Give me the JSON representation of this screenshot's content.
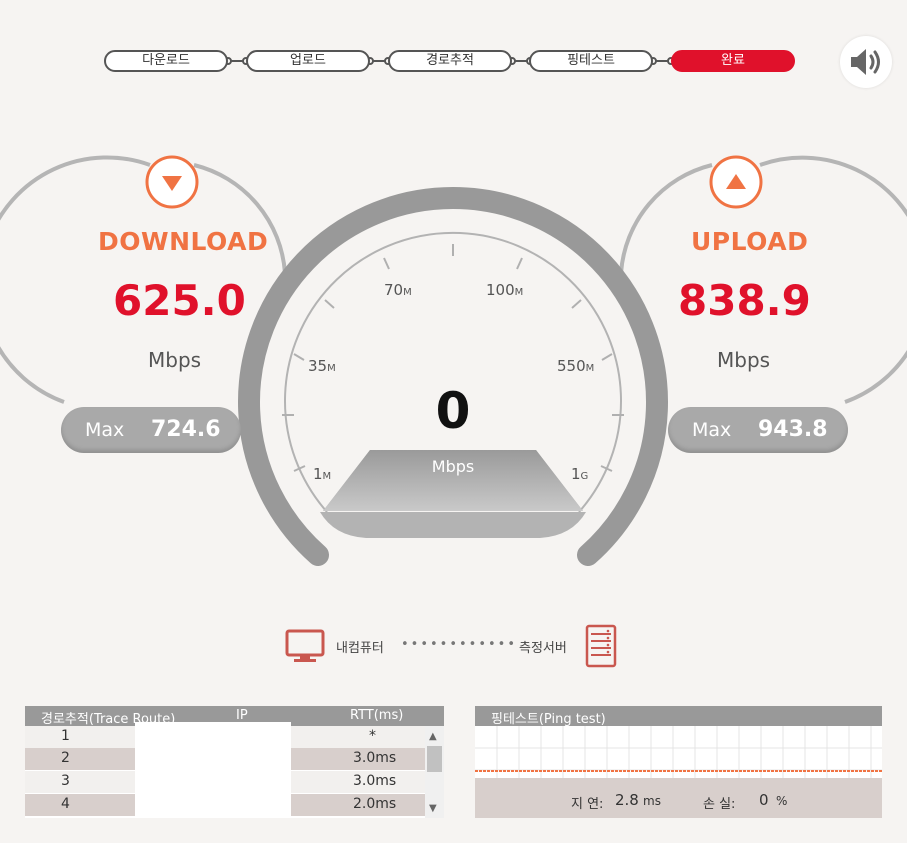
{
  "steps": [
    {
      "label": "다운로드",
      "active": false
    },
    {
      "label": "업로드",
      "active": false
    },
    {
      "label": "경로추적",
      "active": false
    },
    {
      "label": "핑테스트",
      "active": false
    },
    {
      "label": "완료",
      "active": true
    }
  ],
  "download": {
    "label": "DOWNLOAD",
    "value": "625.0",
    "unit": "Mbps",
    "max_label": "Max",
    "max_value": "724.6"
  },
  "upload": {
    "label": "UPLOAD",
    "value": "838.9",
    "unit": "Mbps",
    "max_label": "Max",
    "max_value": "943.8"
  },
  "gauge": {
    "value": "0",
    "unit": "Mbps",
    "ticks": [
      {
        "num": "1",
        "suffix": "M"
      },
      {
        "num": "35",
        "suffix": "M"
      },
      {
        "num": "70",
        "suffix": "M"
      },
      {
        "num": "100",
        "suffix": "M"
      },
      {
        "num": "550",
        "suffix": "M"
      },
      {
        "num": "1",
        "suffix": "G"
      }
    ]
  },
  "connection": {
    "local_label": "내컴퓨터",
    "dots": "••••••••••••",
    "server_label": "측정서버"
  },
  "trace": {
    "headers": {
      "hop": "경로추적(Trace Route)",
      "ip": "IP",
      "rtt": "RTT(ms)"
    },
    "rows": [
      {
        "hop": "1",
        "rtt": "*"
      },
      {
        "hop": "2",
        "rtt": "3.0ms"
      },
      {
        "hop": "3",
        "rtt": "3.0ms"
      },
      {
        "hop": "4",
        "rtt": "2.0ms"
      }
    ]
  },
  "ping": {
    "title": "핑테스트(Ping test)",
    "latency_label": "지 연:",
    "latency_value": "2.8",
    "latency_unit": "ms",
    "loss_label": "손 실:",
    "loss_value": "0",
    "loss_unit": "%"
  },
  "colors": {
    "accent_red": "#e0112b",
    "accent_orange": "#f07343",
    "gauge_gray": "#9a9a9a"
  },
  "icons": [
    "speaker-icon",
    "download-arrow-icon",
    "upload-arrow-icon",
    "monitor-icon",
    "server-icon"
  ]
}
